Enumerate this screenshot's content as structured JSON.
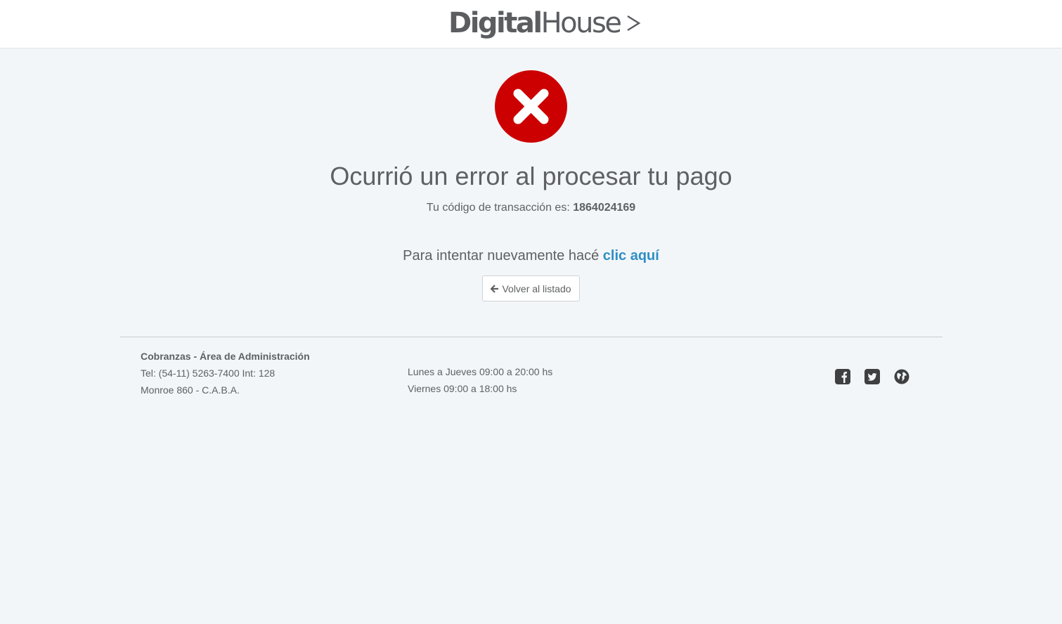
{
  "header": {
    "logo_bold": "Digital",
    "logo_light": "House"
  },
  "main": {
    "title": "Ocurrió un error al procesar tu pago",
    "transaction_label": "Tu código de transacción es:",
    "transaction_code": "1864024169",
    "retry_text": "Para intentar nuevamente hacé",
    "retry_link": "clic aquí",
    "back_button": "Volver al listado"
  },
  "footer": {
    "dept": "Cobranzas - Área de Administración",
    "phone": "Tel: (54-11) 5263-7400 Int: 128",
    "address": "Monroe 860 - C.A.B.A.",
    "hours_weekdays": "Lunes a Jueves 09:00 a 20:00 hs",
    "hours_friday": "Viernes 09:00 a 18:00 hs",
    "social": [
      "facebook-icon",
      "twitter-icon",
      "globe-icon"
    ]
  },
  "colors": {
    "error_red": "#cc0000",
    "link_blue": "#2e8fc6",
    "background": "#f3f6f9"
  }
}
